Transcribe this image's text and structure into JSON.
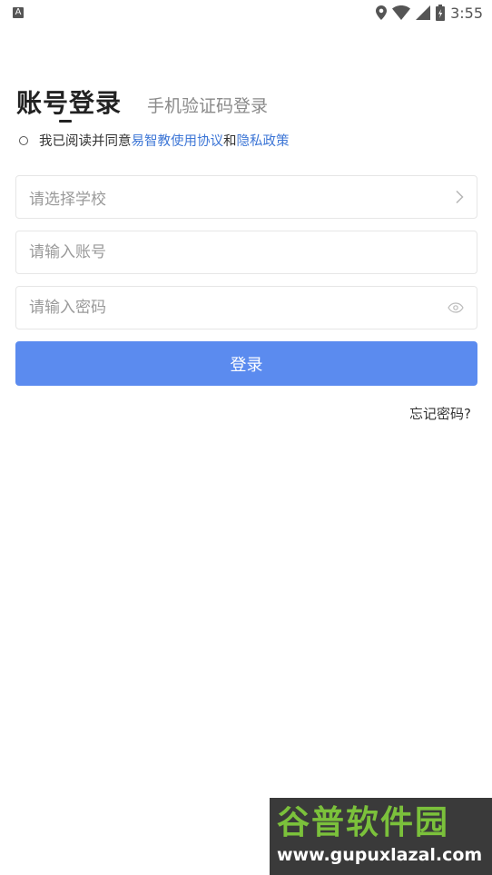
{
  "status_bar": {
    "notification_letter": "A",
    "time": "3:55"
  },
  "tabs": {
    "active": "账号登录",
    "inactive": "手机验证码登录"
  },
  "agreement": {
    "prefix": "我已阅读并同意",
    "link1": "易智教使用协议",
    "middle": "和",
    "link2": "隐私政策"
  },
  "fields": {
    "school_placeholder": "请选择学校",
    "account_placeholder": "请输入账号",
    "password_placeholder": "请输入密码"
  },
  "login_button": "登录",
  "forgot_password": "忘记密码?",
  "watermark": {
    "brand": "谷普软件园",
    "url": "www.gupuxlazal.com"
  },
  "colors": {
    "primary": "#5b8bef",
    "link": "#3d76d6",
    "watermark_green": "#7bc13b"
  }
}
